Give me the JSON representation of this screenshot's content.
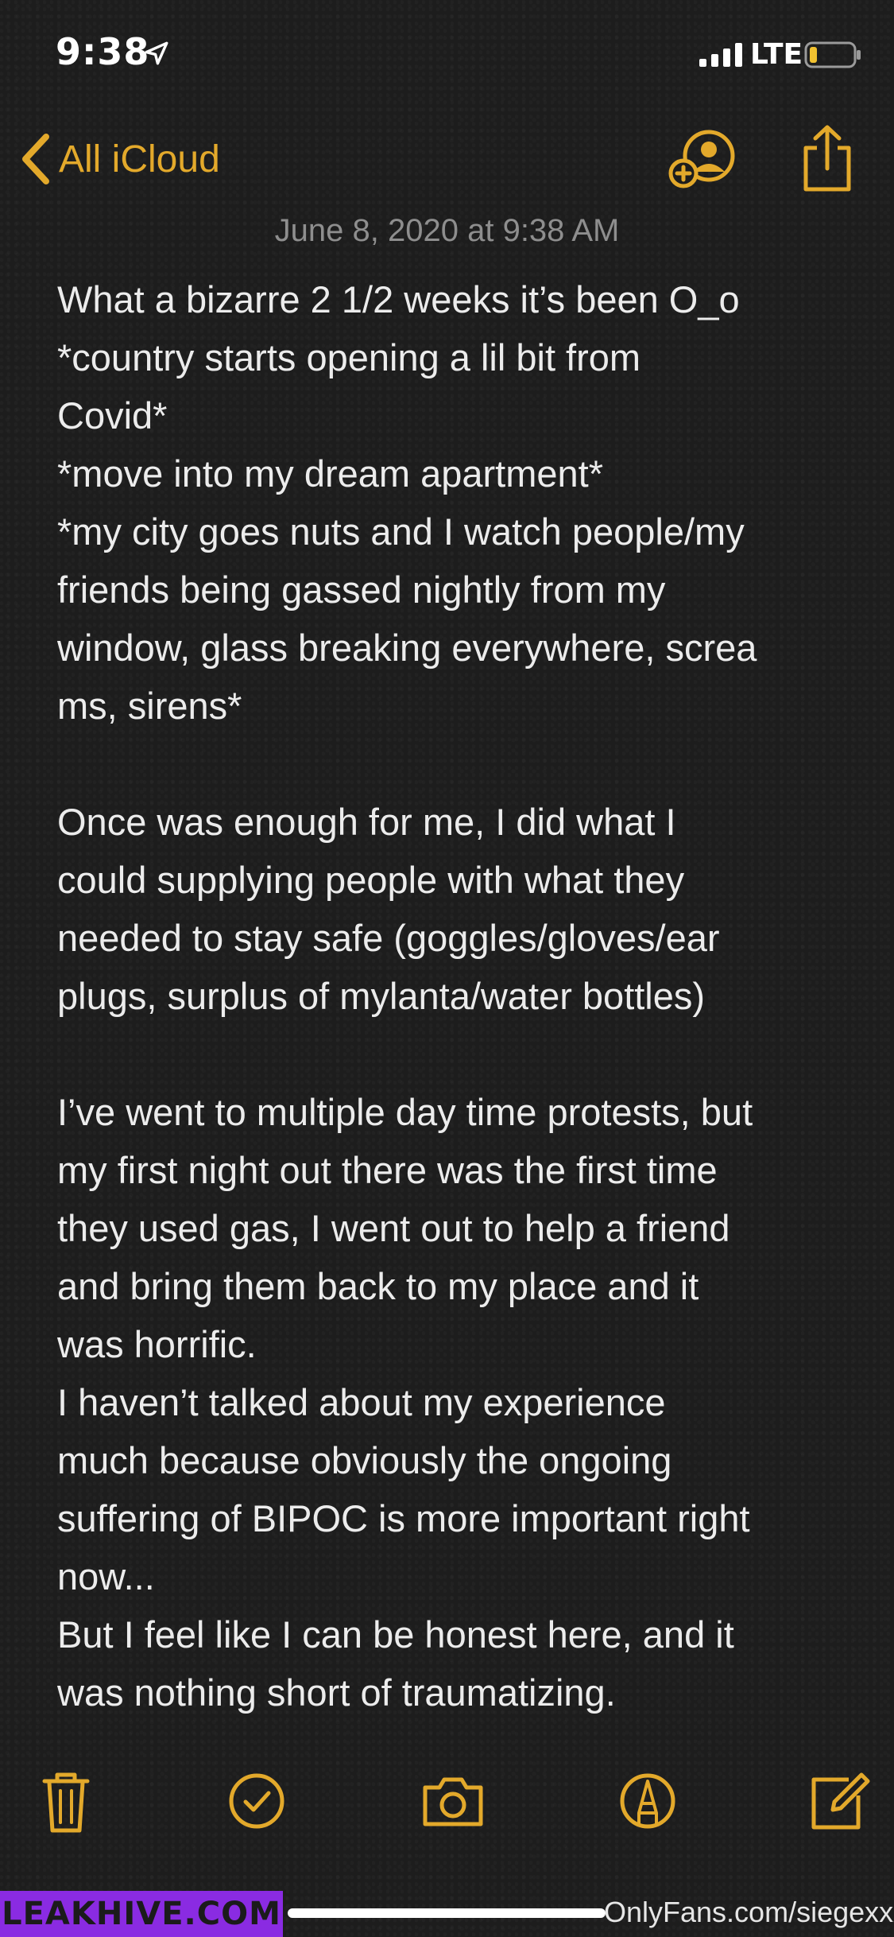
{
  "status_bar": {
    "time": "9:38",
    "network": "LTE",
    "icons": [
      "location-arrow-icon",
      "cellular-signal-icon",
      "battery-low-icon"
    ]
  },
  "nav": {
    "back_label": "All iCloud",
    "icons": [
      "chevron-left-icon",
      "add-person-icon",
      "share-icon"
    ]
  },
  "note": {
    "date": "June 8, 2020 at 9:38 AM",
    "lines": [
      "What a bizarre 2 1/2 weeks it’s been O_o",
      "*country starts opening a lil bit from",
      "Covid*",
      "*move into my dream apartment*",
      "*my city goes nuts and I watch people/my",
      "friends being gassed nightly from my",
      "window, glass breaking everywhere, screa",
      "ms, sirens*",
      "",
      "Once was enough for me, I did what I",
      "could supplying people with what they",
      "needed to stay safe (goggles/gloves/ear",
      "plugs, surplus of mylanta/water bottles)",
      "",
      "I’ve went to multiple day time protests, but",
      "my first night out there was the first time",
      "they used gas, I went out to help a friend",
      "and bring them back to my place and it",
      "was horrific.",
      "I haven’t talked about my experience",
      "much because obviously the ongoing",
      "suffering of BIPOC is more important right",
      "now...",
      "But I feel like I can be honest here, and it",
      "was nothing short of traumatizing."
    ]
  },
  "toolbar": {
    "icons": [
      "trash-icon",
      "checklist-icon",
      "camera-icon",
      "markup-pen-icon",
      "compose-icon"
    ]
  },
  "watermark": {
    "site_label": "LEAKHIVE.COM",
    "credit": "OnlyFans.com/siegexxx"
  },
  "colors": {
    "accent": "#e3a92b",
    "background": "#1d1d1d",
    "text": "#ececec",
    "date": "#8e8e8e",
    "badge": "#8a2be2"
  }
}
